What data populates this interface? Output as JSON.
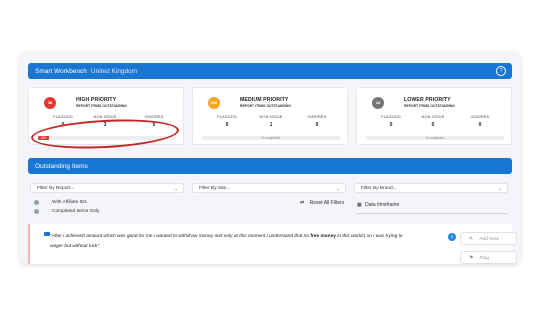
{
  "header": {
    "title": "Smart Workbench",
    "region": "United Kingdom",
    "help_glyph": "?"
  },
  "cards": [
    {
      "badge": "38",
      "color": "#e53935",
      "title": "HIGH PRIORITY",
      "subtitle": "REPORT ITEMS OUTSTANDING",
      "flagged_label": "FLAGGED",
      "flagged": "0",
      "nonissue_label": "NON-ISSUE",
      "nonissue": "3",
      "ignored_label": "IGNORED",
      "ignored": "0",
      "progress_label": "8%",
      "progress_fraction": 0.08
    },
    {
      "badge": "330",
      "color": "#f5a623",
      "title": "MEDIUM PRIORITY",
      "subtitle": "REPORT ITEMS OUTSTANDING",
      "flagged_label": "FLAGGED",
      "flagged": "0",
      "nonissue_label": "NON-ISSUE",
      "nonissue": "1",
      "ignored_label": "IGNORED",
      "ignored": "0",
      "progress_label": "% completed",
      "progress_fraction": 0
    },
    {
      "badge": "18",
      "color": "#757575",
      "title": "LOWER PRIORITY",
      "subtitle": "REPORT ITEMS OUTSTANDING",
      "flagged_label": "FLAGGED",
      "flagged": "0",
      "nonissue_label": "NON-ISSUE",
      "nonissue": "0",
      "ignored_label": "IGNORED",
      "ignored": "0",
      "progress_label": "% completed",
      "progress_fraction": 0
    }
  ],
  "outstanding": {
    "title": "Outstanding Items",
    "filter_report": "Filter By Report...",
    "filter_site": "Filter By Site...",
    "filter_brand": "Filter By Brand...",
    "caret": "⌄",
    "option_affiliate": "With Affiliate IDs",
    "option_completed": "Completed Items Only",
    "reset_label": "Reset All Filters",
    "timeframe_label": "Data timeframe"
  },
  "item": {
    "text_before": "\"After i achieved amount which was good for me i wanted to withdraw money and only at this moment i understand that no ",
    "text_bold": "free money",
    "text_after": " in this world:) so i was trying to wager but without luck\"",
    "badge": "0",
    "add_note_label": "Add Note",
    "flag_label": "Flag"
  }
}
